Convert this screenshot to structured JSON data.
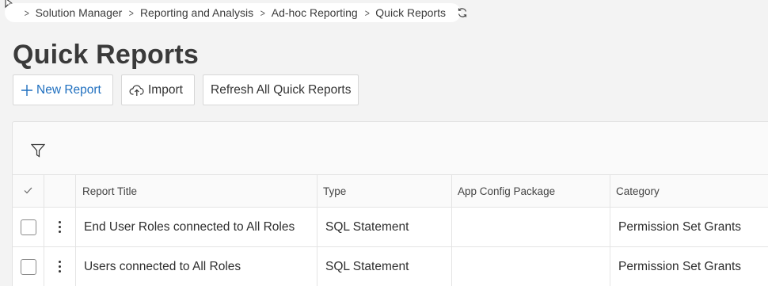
{
  "breadcrumb": {
    "items": [
      "Solution Manager",
      "Reporting and Analysis",
      "Ad-hoc Reporting",
      "Quick Reports"
    ],
    "separator": ">",
    "home_color": "#1b6ac9"
  },
  "page": {
    "title": "Quick Reports"
  },
  "toolbar": {
    "new_report_label": "New Report",
    "import_label": "Import",
    "refresh_all_label": "Refresh All Quick Reports"
  },
  "table": {
    "columns": [
      "Report Title",
      "Type",
      "App Config Package",
      "Category"
    ],
    "rows": [
      {
        "title": "End User Roles connected to All Roles",
        "type": "SQL Statement",
        "package": "",
        "category": "Permission Set Grants"
      },
      {
        "title": "Users connected to All Roles",
        "type": "SQL Statement",
        "package": "",
        "category": "Permission Set Grants"
      }
    ]
  },
  "colors": {
    "accent": "#1f6fbf",
    "background": "#f3f3f3"
  }
}
